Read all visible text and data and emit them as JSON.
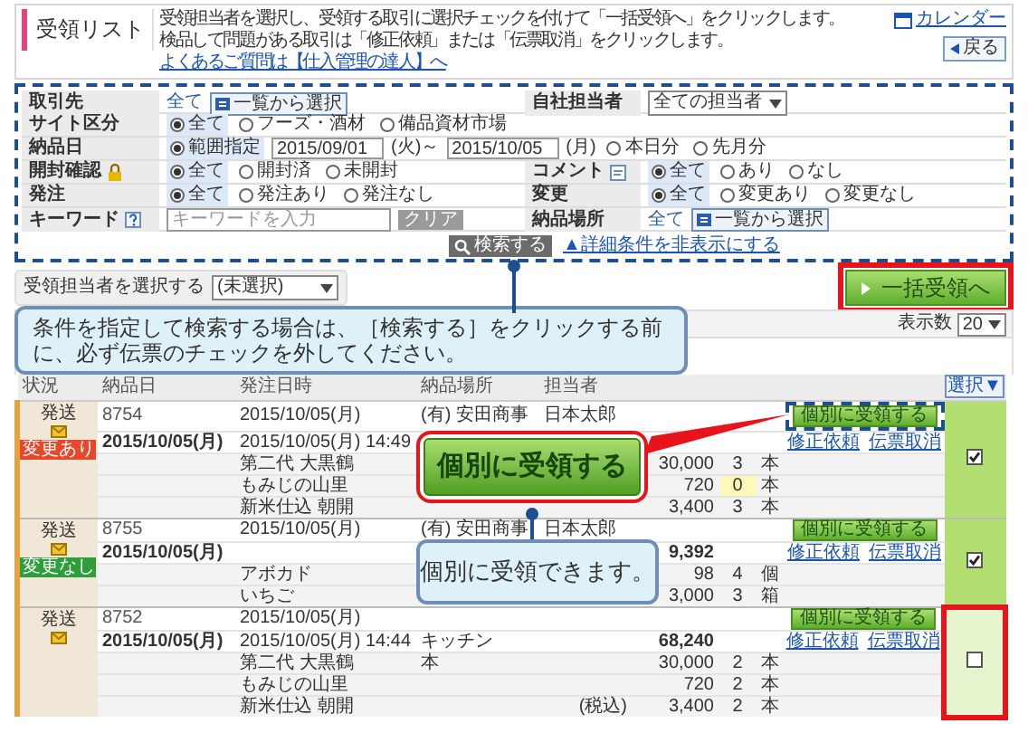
{
  "header": {
    "title": "受領リスト",
    "description": [
      "受領担当者を選択し、受領する取引に選択チェックを付けて「一括受領へ」をクリックします。",
      "検品して問題がある取引は「修正依頼」または「伝票取消」をクリックします。"
    ],
    "faq_link": "よくあるご質問は【仕入管理の達人】へ",
    "calendar_link": "カレンダー",
    "back_button": "戻る"
  },
  "search": {
    "rows": [
      {
        "fields": [
          {
            "kind": "pick",
            "label": "取引先",
            "value": "全て",
            "button": "一覧から選択"
          },
          {
            "kind": "dropdown",
            "label": "自社担当者",
            "value": "全ての担当者"
          }
        ]
      },
      {
        "fields": [
          {
            "kind": "radios",
            "label": "サイト区分",
            "options": [
              {
                "label": "全て",
                "selected": true
              },
              {
                "label": "フーズ・酒材",
                "selected": false
              },
              {
                "label": "備品資材市場",
                "selected": false
              }
            ]
          }
        ]
      },
      {
        "fields": [
          {
            "kind": "date_range",
            "label": "納品日",
            "options": [
              {
                "label": "範囲指定",
                "selected": true
              }
            ],
            "from": "2015/09/01",
            "from_day": "(火)～",
            "to": "2015/10/05",
            "to_day": "(月)",
            "extra_options": [
              {
                "label": "本日分",
                "selected": false
              },
              {
                "label": "先月分",
                "selected": false
              }
            ]
          }
        ]
      },
      {
        "fields": [
          {
            "kind": "radios",
            "label": "開封確認",
            "options": [
              {
                "label": "全て",
                "selected": true
              },
              {
                "label": "開封済",
                "selected": false
              },
              {
                "label": "未開封",
                "selected": false
              }
            ]
          },
          {
            "kind": "radios",
            "label": "コメント",
            "options": [
              {
                "label": "全て",
                "selected": true
              },
              {
                "label": "あり",
                "selected": false
              },
              {
                "label": "なし",
                "selected": false
              }
            ]
          }
        ]
      },
      {
        "fields": [
          {
            "kind": "radios",
            "label": "発注",
            "options": [
              {
                "label": "全て",
                "selected": true
              },
              {
                "label": "発注あり",
                "selected": false
              },
              {
                "label": "発注なし",
                "selected": false
              }
            ]
          },
          {
            "kind": "radios",
            "label": "変更",
            "options": [
              {
                "label": "全て",
                "selected": true
              },
              {
                "label": "変更あり",
                "selected": false
              },
              {
                "label": "変更なし",
                "selected": false
              }
            ]
          }
        ]
      },
      {
        "fields": [
          {
            "kind": "keyword",
            "label": "キーワード",
            "placeholder": "キーワードを入力",
            "button": "クリア"
          },
          {
            "kind": "pick",
            "label": "納品場所",
            "value": "全て",
            "button": "一覧から選択"
          }
        ]
      }
    ],
    "search_button": "検索する",
    "toggle_link": "▲詳細条件を非表示にする"
  },
  "controls": {
    "assignee_label": "受領担当者を選択する",
    "assignee_value": "(未選択)",
    "bulk_button": "一括受領へ",
    "page_size_label": "表示数",
    "page_size": "20"
  },
  "table": {
    "columns": [
      "状況",
      "納品日",
      "発注日時",
      "納品場所",
      "担当者"
    ],
    "select_button": "選択▼",
    "orders": [
      {
        "status": "発送",
        "tag": "変更あり",
        "color": "#e8472c",
        "number": "8754",
        "date": "2015/10/05(月)",
        "order_date": "2015/10/05(月)",
        "order_time": "2015/10/05(月) 14:49",
        "place": "(有) 安田商事",
        "person": "日本太郎",
        "receive_button": "個別に受領する",
        "links": [
          "修正依頼",
          "伝票取消"
        ],
        "checked": true,
        "button_outlined": true,
        "check_outlined": false,
        "items": [
          {
            "name": "第二代 大黒鶴",
            "price": "30,000",
            "qty": "3",
            "unit": "本",
            "highlighted": false
          },
          {
            "name": "もみじの山里",
            "price": "720",
            "qty": "0",
            "unit": "本",
            "highlighted": true
          },
          {
            "name": "新米仕込 朝開",
            "price": "3,400",
            "qty": "3",
            "unit": "本",
            "highlighted": false
          }
        ]
      },
      {
        "status": "発送",
        "tag": "変更なし",
        "color": "#2e9e3a",
        "number": "8755",
        "date": "2015/10/05(月)",
        "order_date": "2015/10/05(月)",
        "place": "(有) 安田商事",
        "person": "日本太郎",
        "total": "9,392",
        "receive_button": "個別に受領する",
        "links": [
          "修正依頼",
          "伝票取消"
        ],
        "checked": true,
        "button_outlined": false,
        "check_outlined": false,
        "items": [
          {
            "name": "アボカド",
            "price": "98",
            "qty": "4",
            "unit": "個",
            "highlighted": false
          },
          {
            "name": "いちご",
            "price": "3,000",
            "qty": "3",
            "unit": "箱",
            "highlighted": false
          }
        ]
      },
      {
        "status": "発送",
        "number": "8752",
        "date": "2015/10/05(月)",
        "order_date": "2015/10/05(月)",
        "order_time": "2015/10/05(月) 14:44",
        "second_place": "キッチン",
        "total": "68,240",
        "receive_button": "個別に受領する",
        "links": [
          "修正依頼",
          "伝票取消"
        ],
        "checked": false,
        "button_outlined": false,
        "check_outlined": true,
        "items": [
          {
            "name": "第二代 大黒鶴",
            "note": "本",
            "price": "30,000",
            "qty": "2",
            "unit": "本",
            "highlighted": false
          },
          {
            "name": "もみじの山里",
            "price": "720",
            "qty": "2",
            "unit": "本",
            "highlighted": false
          },
          {
            "name": "新米仕込 朝開",
            "tax": "(税込)",
            "price": "3,400",
            "qty": "2",
            "unit": "本",
            "highlighted": false
          }
        ]
      }
    ]
  },
  "callouts": {
    "search_note": "条件を指定して検索する場合は、［検索する］をクリックする前に、必ず伝票のチェックを外してください。",
    "big_button": "個別に受領する",
    "receive_note": "個別に受領できます。"
  }
}
